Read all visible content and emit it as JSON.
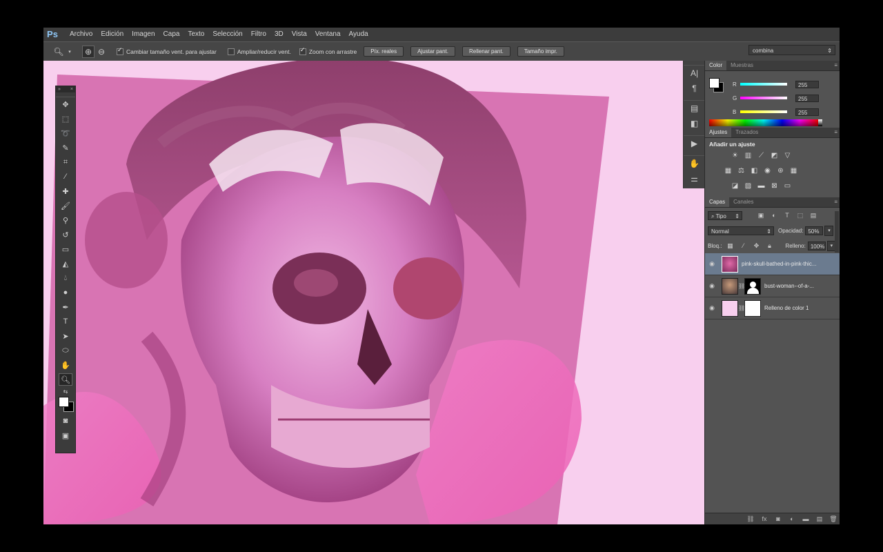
{
  "app": {
    "logo": "Ps"
  },
  "menu": [
    "Archivo",
    "Edición",
    "Imagen",
    "Capa",
    "Texto",
    "Selección",
    "Filtro",
    "3D",
    "Vista",
    "Ventana",
    "Ayuda"
  ],
  "options": {
    "cb1": "Cambiar tamaño vent. para ajustar",
    "cb2": "Ampliar/reducir vent.",
    "cb3": "Zoom con arrastre",
    "btn1": "Píx. reales",
    "btn2": "Ajustar pant.",
    "btn3": "Rellenar pant.",
    "btn4": "Tamaño impr.",
    "workspace": "combina"
  },
  "color_panel": {
    "tab1": "Color",
    "tab2": "Muestras",
    "r_label": "R",
    "g_label": "G",
    "b_label": "B",
    "r": "255",
    "g": "255",
    "b": "255"
  },
  "adjust_panel": {
    "tab1": "Ajustes",
    "tab2": "Trazados",
    "title": "Añadir un ajuste"
  },
  "layers_panel": {
    "tab1": "Capas",
    "tab2": "Canales",
    "filter": "Tipo",
    "blend": "Normal",
    "opacity_label": "Opacidad:",
    "opacity": "50%",
    "lock_label": "Bloq.:",
    "fill_label": "Relleno:",
    "fill": "100%",
    "layers": [
      {
        "name": "pink-skull-bathed-in-pink-thic..."
      },
      {
        "name": "bust-woman--of-a-..."
      },
      {
        "name": "Relleno de color 1"
      }
    ]
  },
  "colors": {
    "canvas": "#f8cfee",
    "selected_layer": "#6b7b8f"
  }
}
